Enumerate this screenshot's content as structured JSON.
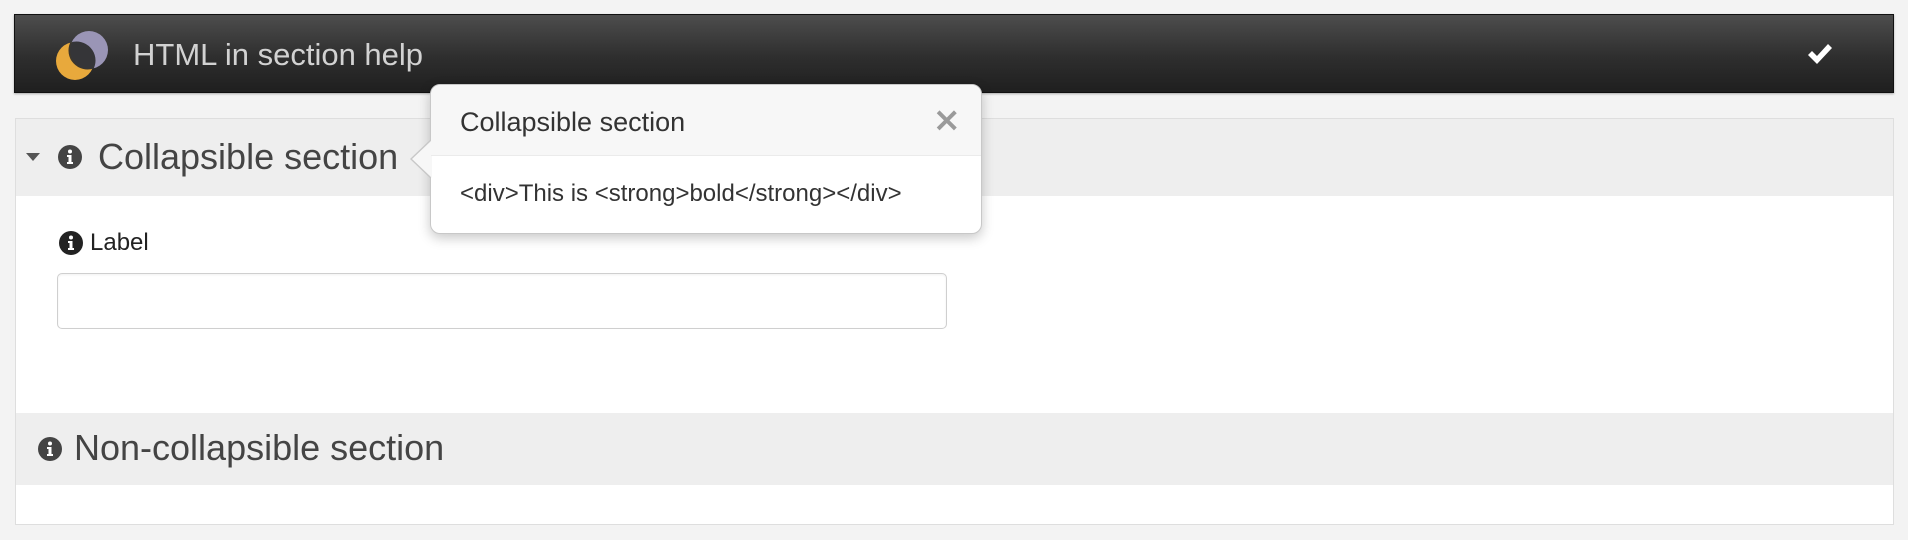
{
  "header": {
    "title": "HTML in section help",
    "logo_icon": "overlapping-circles-logo",
    "confirm_icon": "checkmark-icon"
  },
  "sections": [
    {
      "title": "Collapsible section",
      "collapsible": true,
      "expanded": true,
      "fields": [
        {
          "label": "Label",
          "value": "",
          "placeholder": ""
        }
      ]
    },
    {
      "title": "Non-collapsible section",
      "collapsible": false
    }
  ],
  "popover": {
    "title": "Collapsible section",
    "close_glyph": "×",
    "body": "<div>This is <strong>bold</strong></div>"
  },
  "colors": {
    "header_dark": "#2e2e2e",
    "logo_gold": "#e8a93c",
    "logo_lavender": "#9a95b6",
    "section_bg": "#eeeeee"
  }
}
